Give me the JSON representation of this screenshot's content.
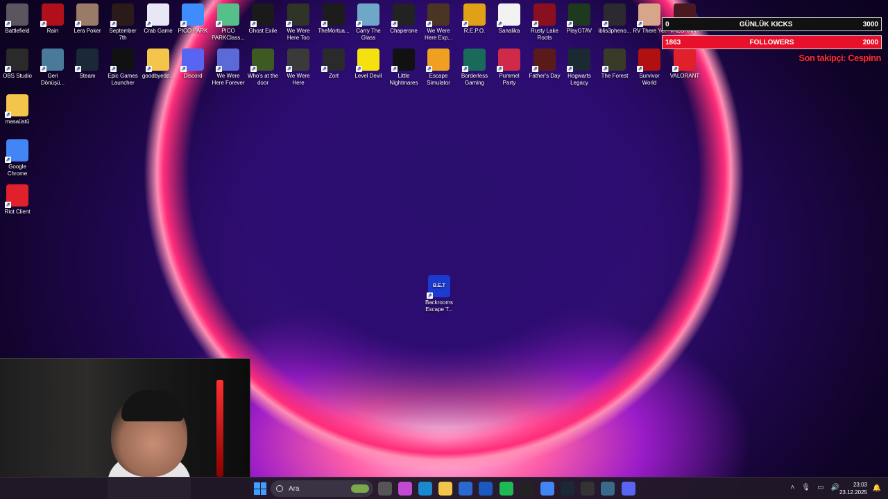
{
  "desktop_icons": [
    {
      "label": "Battlefield",
      "icon": "battlefield-icon",
      "color": "#5b5560"
    },
    {
      "label": "Rain",
      "icon": "red-devil-icon",
      "color": "#b0101a"
    },
    {
      "label": "Lera Poker",
      "icon": "poker-icon",
      "color": "#9a7b68"
    },
    {
      "label": "September 7th",
      "icon": "september-icon",
      "color": "#2a1a1a"
    },
    {
      "label": "Crab Game",
      "icon": "crab-game-icon",
      "color": "#e8e8f4"
    },
    {
      "label": "PICO PARK",
      "icon": "pico-park-icon",
      "color": "#3f8cff"
    },
    {
      "label": "PICO PARKClass...",
      "icon": "pico-park-classic-icon",
      "color": "#56c08a"
    },
    {
      "label": "Ghost Exile",
      "icon": "ghost-exile-icon",
      "color": "#1a1a1a"
    },
    {
      "label": "We Were Here Too",
      "icon": "we-were-here-too-icon",
      "color": "#2f3328"
    },
    {
      "label": "TheMortua...",
      "icon": "mortuary-icon",
      "color": "#1c1c1c"
    },
    {
      "label": "Carry The Glass",
      "icon": "carry-glass-icon",
      "color": "#6ea7c8"
    },
    {
      "label": "Chaperone",
      "icon": "chaperone-icon",
      "color": "#222"
    },
    {
      "label": "We Were Here Exp...",
      "icon": "we-were-here-expeditions-icon",
      "color": "#4a3524"
    },
    {
      "label": "R.E.P.O.",
      "icon": "repo-icon",
      "color": "#e0a116"
    },
    {
      "label": "Sanalika",
      "icon": "sanalika-icon",
      "color": "#f2f2f2"
    },
    {
      "label": "Rusty Lake Roots",
      "icon": "rusty-lake-icon",
      "color": "#8a1020"
    },
    {
      "label": "PlayGTAV",
      "icon": "gtav-icon",
      "color": "#1e3a1e"
    },
    {
      "label": "iblis3pheno...",
      "icon": "iblis-icon",
      "color": "#2a2a30"
    },
    {
      "label": "RV There Yet",
      "icon": "rv-there-yet-icon",
      "color": "#d7a58a"
    },
    {
      "label": "VALORANT",
      "icon": "valorant-icon",
      "color": "#4a1820"
    },
    {
      "label": "OBS Studio",
      "icon": "obs-icon",
      "color": "#2a2a2a"
    },
    {
      "label": "Geri Dönüşü...",
      "icon": "recycle-bin-icon",
      "color": "#4a7a9a"
    },
    {
      "label": "Steam",
      "icon": "steam-icon",
      "color": "#1b2838"
    },
    {
      "label": "Epic Games Launcher",
      "icon": "epic-games-icon",
      "color": "#111"
    },
    {
      "label": "goodbyedp...",
      "icon": "folder-icon",
      "color": "#f3c64b"
    },
    {
      "label": "Discord",
      "icon": "discord-icon",
      "color": "#5865f2"
    },
    {
      "label": "We Were Here Forever",
      "icon": "we-were-here-forever-icon",
      "color": "#5c6ad8"
    },
    {
      "label": "Who's at the door",
      "icon": "whos-at-door-icon",
      "color": "#3c5a22"
    },
    {
      "label": "We Were Here",
      "icon": "we-were-here-icon",
      "color": "#3a3a3a"
    },
    {
      "label": "Zort",
      "icon": "zort-icon",
      "color": "#2a2a2a"
    },
    {
      "label": "Level Devil",
      "icon": "level-devil-icon",
      "color": "#f5e010"
    },
    {
      "label": "Little Nightmares",
      "icon": "little-nightmares-icon",
      "color": "#111"
    },
    {
      "label": "Escape Simulator",
      "icon": "escape-sim-icon",
      "color": "#f0a020"
    },
    {
      "label": "Borderless Gaming",
      "icon": "borderless-icon",
      "color": "#1a6a5a"
    },
    {
      "label": "Pummel Party",
      "icon": "pummel-party-icon",
      "color": "#d02a4a"
    },
    {
      "label": "Father's Day",
      "icon": "fathers-day-icon",
      "color": "#5a1a1a"
    },
    {
      "label": "Hogwarts Legacy",
      "icon": "hogwarts-icon",
      "color": "#1a2a30"
    },
    {
      "label": "The Forest",
      "icon": "the-forest-icon",
      "color": "#3a3a28"
    },
    {
      "label": "Survivor World",
      "icon": "survivor-world-icon",
      "color": "#b01010"
    },
    {
      "label": "VALORANT",
      "icon": "valorant-client-icon",
      "color": "#e0202a"
    },
    {
      "label": "masaüstü",
      "icon": "folder-icon",
      "color": "#f3c64b"
    },
    {
      "label": "Google Chrome",
      "icon": "chrome-icon",
      "color": "#4285f4"
    },
    {
      "label": "Riot Client",
      "icon": "riot-client-icon",
      "color": "#e0202a"
    },
    {
      "label": "Backrooms Escape T...",
      "icon": "backrooms-icon",
      "color": "#1a3ad0",
      "badge": "B.E.T"
    }
  ],
  "overlay": {
    "kicks_label": "GÜNLÜK KICKS",
    "kicks_value": "0",
    "kicks_goal": "3000",
    "followers_label": "FOLLOWERS",
    "followers_value": "1863",
    "followers_goal": "2000",
    "last_follower": "Son takipçi: Cespinn"
  },
  "taskbar": {
    "search_placeholder": "Ara",
    "time": "23:03",
    "date": "23.12.2025",
    "apps": [
      {
        "icon": "task-view-icon",
        "color": "#555"
      },
      {
        "icon": "copilot-icon",
        "color": "#c04ad0"
      },
      {
        "icon": "edge-icon",
        "color": "#1a8ad0"
      },
      {
        "icon": "file-explorer-icon",
        "color": "#f3c64b"
      },
      {
        "icon": "store-icon",
        "color": "#2a6ad0"
      },
      {
        "icon": "outlook-icon",
        "color": "#1a5ac0"
      },
      {
        "icon": "spotify-icon",
        "color": "#1db954"
      },
      {
        "icon": "epic-games-icon",
        "color": "#222"
      },
      {
        "icon": "chrome-icon",
        "color": "#4285f4"
      },
      {
        "icon": "steam-icon",
        "color": "#1b2838"
      },
      {
        "icon": "obs-icon",
        "color": "#333"
      },
      {
        "icon": "app-icon",
        "color": "#3a6a8a"
      },
      {
        "icon": "discord-icon",
        "color": "#5865f2"
      }
    ]
  }
}
